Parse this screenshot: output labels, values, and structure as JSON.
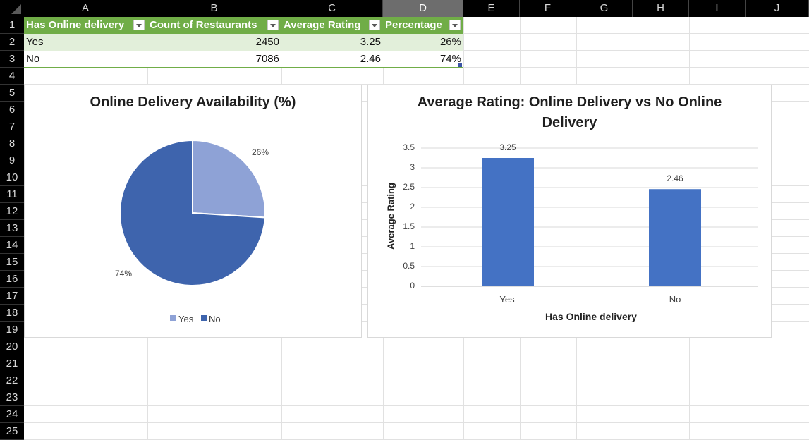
{
  "columns": [
    "A",
    "B",
    "C",
    "D",
    "E",
    "F",
    "G",
    "H",
    "I",
    "J"
  ],
  "rows": [
    "1",
    "2",
    "3",
    "4",
    "5",
    "6",
    "7",
    "8",
    "9",
    "10",
    "11",
    "12",
    "13",
    "14",
    "15",
    "16",
    "17",
    "18",
    "19",
    "20",
    "21",
    "22",
    "23",
    "24",
    "25"
  ],
  "table": {
    "headers": [
      "Has Online delivery",
      "Count of Restaurants",
      "Average Rating",
      "Percentage"
    ],
    "rows": [
      {
        "delivery": "Yes",
        "count": "2450",
        "rating": "3.25",
        "pct": "26%"
      },
      {
        "delivery": "No",
        "count": "7086",
        "rating": "2.46",
        "pct": "74%"
      }
    ]
  },
  "pie_chart": {
    "title": "Online Delivery Availability (%)",
    "labels": [
      "26%",
      "74%"
    ],
    "legend": [
      "Yes",
      "No"
    ],
    "colors": [
      "#8ea2d6",
      "#3e64ad"
    ]
  },
  "bar_chart": {
    "title_line1": "Average Rating: Online Delivery vs No Online",
    "title_line2": "Delivery",
    "ylabel": "Average Rating",
    "xlabel": "Has Online delivery",
    "ticks": [
      "3.5",
      "3",
      "2.5",
      "2",
      "1.5",
      "1",
      "0.5",
      "0"
    ],
    "categories": [
      "Yes",
      "No"
    ],
    "value_labels": [
      "3.25",
      "2.46"
    ],
    "color": "#4472c4"
  },
  "chart_data": [
    {
      "type": "pie",
      "title": "Online Delivery Availability (%)",
      "categories": [
        "Yes",
        "No"
      ],
      "values": [
        26,
        74
      ],
      "legend": "bottom"
    },
    {
      "type": "bar",
      "title": "Average Rating: Online Delivery vs No Online Delivery",
      "categories": [
        "Yes",
        "No"
      ],
      "values": [
        3.25,
        2.46
      ],
      "xlabel": "Has Online delivery",
      "ylabel": "Average Rating",
      "ylim": [
        0,
        3.5
      ],
      "grid": true
    }
  ]
}
